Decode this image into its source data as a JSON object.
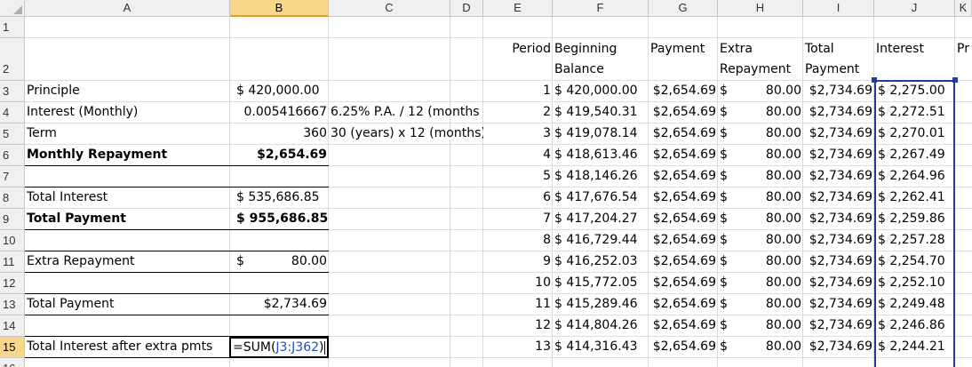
{
  "columns": [
    "A",
    "B",
    "C",
    "D",
    "E",
    "F",
    "G",
    "H",
    "I",
    "J",
    "K"
  ],
  "rows": [
    "1",
    "2",
    "3",
    "4",
    "5",
    "6",
    "7",
    "8",
    "9",
    "10",
    "11",
    "12",
    "13",
    "14",
    "15",
    "16"
  ],
  "header_row": {
    "period": "Period",
    "beginning_1": "Beginning",
    "beginning_2": "Balance",
    "payment": "Payment",
    "extra_1": "Extra",
    "extra_2": "Repayment",
    "total_1": "Total",
    "total_2": "Payment",
    "interest": "Interest",
    "overflow": "Pr"
  },
  "summary": {
    "principle_label": "Principle",
    "principle_value": "$ 420,000.00",
    "interest_label": "Interest (Monthly)",
    "interest_value": "0.005416667",
    "interest_note": "6.25% P.A. / 12 (months",
    "term_label": "Term",
    "term_value": "360",
    "term_note": "30 (years) x 12 (months)",
    "monthly_label": "Monthly Repayment",
    "monthly_value": "$2,654.69",
    "total_interest_label": "Total Interest",
    "total_interest_value": "$ 535,686.85",
    "total_payment_label": "Total Payment",
    "total_payment_value": "$ 955,686.85",
    "extra_label": "Extra Repayment",
    "extra_currency": "$",
    "extra_value": "80.00",
    "total_payment2_label": "Total Payment",
    "total_payment2_value": "$2,734.69",
    "after_label": "Total Interest after extra pmts",
    "formula_prefix": "=SUM(",
    "formula_ref": "J3:J362",
    "formula_suffix": ")"
  },
  "schedule": [
    {
      "period": "1",
      "balance": "$ 420,000.00",
      "payment": "$2,654.69",
      "extra_sym": "$",
      "extra": "80.00",
      "total": "$2,734.69",
      "interest": "$ 2,275.00"
    },
    {
      "period": "2",
      "balance": "$ 419,540.31",
      "payment": "$2,654.69",
      "extra_sym": "$",
      "extra": "80.00",
      "total": "$2,734.69",
      "interest": "$ 2,272.51"
    },
    {
      "period": "3",
      "balance": "$ 419,078.14",
      "payment": "$2,654.69",
      "extra_sym": "$",
      "extra": "80.00",
      "total": "$2,734.69",
      "interest": "$ 2,270.01"
    },
    {
      "period": "4",
      "balance": "$ 418,613.46",
      "payment": "$2,654.69",
      "extra_sym": "$",
      "extra": "80.00",
      "total": "$2,734.69",
      "interest": "$ 2,267.49"
    },
    {
      "period": "5",
      "balance": "$ 418,146.26",
      "payment": "$2,654.69",
      "extra_sym": "$",
      "extra": "80.00",
      "total": "$2,734.69",
      "interest": "$ 2,264.96"
    },
    {
      "period": "6",
      "balance": "$ 417,676.54",
      "payment": "$2,654.69",
      "extra_sym": "$",
      "extra": "80.00",
      "total": "$2,734.69",
      "interest": "$ 2,262.41"
    },
    {
      "period": "7",
      "balance": "$ 417,204.27",
      "payment": "$2,654.69",
      "extra_sym": "$",
      "extra": "80.00",
      "total": "$2,734.69",
      "interest": "$ 2,259.86"
    },
    {
      "period": "8",
      "balance": "$ 416,729.44",
      "payment": "$2,654.69",
      "extra_sym": "$",
      "extra": "80.00",
      "total": "$2,734.69",
      "interest": "$ 2,257.28"
    },
    {
      "period": "9",
      "balance": "$ 416,252.03",
      "payment": "$2,654.69",
      "extra_sym": "$",
      "extra": "80.00",
      "total": "$2,734.69",
      "interest": "$ 2,254.70"
    },
    {
      "period": "10",
      "balance": "$ 415,772.05",
      "payment": "$2,654.69",
      "extra_sym": "$",
      "extra": "80.00",
      "total": "$2,734.69",
      "interest": "$ 2,252.10"
    },
    {
      "period": "11",
      "balance": "$ 415,289.46",
      "payment": "$2,654.69",
      "extra_sym": "$",
      "extra": "80.00",
      "total": "$2,734.69",
      "interest": "$ 2,249.48"
    },
    {
      "period": "12",
      "balance": "$ 414,804.26",
      "payment": "$2,654.69",
      "extra_sym": "$",
      "extra": "80.00",
      "total": "$2,734.69",
      "interest": "$ 2,246.86"
    },
    {
      "period": "13",
      "balance": "$ 414,316.43",
      "payment": "$2,654.69",
      "extra_sym": "$",
      "extra": "80.00",
      "total": "$2,734.69",
      "interest": "$ 2,244.21"
    }
  ],
  "colors": {
    "header_bg": "#f0f0f0",
    "selected_header_bg": "#f8d68a",
    "gridline": "#dadcdd",
    "formula_ref_color": "#1f4fb5",
    "range_border": "#1f3d99"
  }
}
